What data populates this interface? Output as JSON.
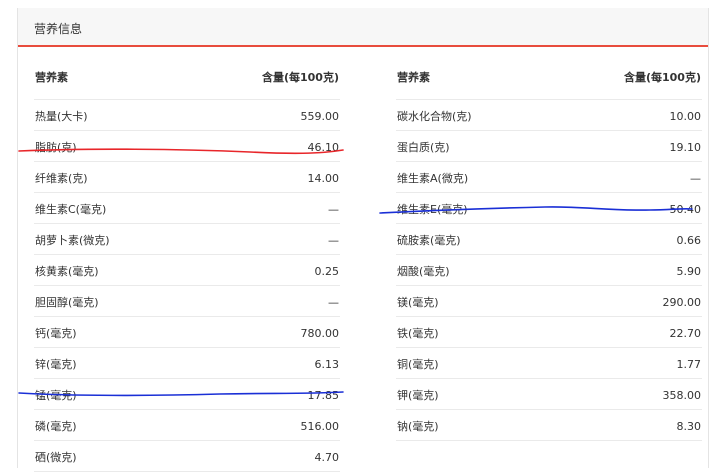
{
  "panel": {
    "title": "营养信息"
  },
  "headers": {
    "nutrient": "营养素",
    "amount": "含量(每100克)"
  },
  "left_rows": [
    {
      "name": "热量(大卡)",
      "value": "559.00"
    },
    {
      "name": "脂肪(克)",
      "value": "46.10"
    },
    {
      "name": "纤维素(克)",
      "value": "14.00"
    },
    {
      "name": "维生素C(毫克)",
      "value": "—"
    },
    {
      "name": "胡萝卜素(微克)",
      "value": "—"
    },
    {
      "name": "核黄素(毫克)",
      "value": "0.25"
    },
    {
      "name": "胆固醇(毫克)",
      "value": "—"
    },
    {
      "name": "钙(毫克)",
      "value": "780.00"
    },
    {
      "name": "锌(毫克)",
      "value": "6.13"
    },
    {
      "name": "锰(毫克)",
      "value": "17.85"
    },
    {
      "name": "磷(毫克)",
      "value": "516.00"
    },
    {
      "name": "硒(微克)",
      "value": "4.70"
    }
  ],
  "right_rows": [
    {
      "name": "碳水化合物(克)",
      "value": "10.00"
    },
    {
      "name": "蛋白质(克)",
      "value": "19.10"
    },
    {
      "name": "维生素A(微克)",
      "value": "—"
    },
    {
      "name": "维生素E(毫克)",
      "value": "50.40"
    },
    {
      "name": "硫胺素(毫克)",
      "value": "0.66"
    },
    {
      "name": "烟酸(毫克)",
      "value": "5.90"
    },
    {
      "name": "镁(毫克)",
      "value": "290.00"
    },
    {
      "name": "铁(毫克)",
      "value": "22.70"
    },
    {
      "name": "铜(毫克)",
      "value": "1.77"
    },
    {
      "name": "钾(毫克)",
      "value": "358.00"
    },
    {
      "name": "钠(毫克)",
      "value": "8.30"
    }
  ],
  "annotation_colors": {
    "red": "#e8262a",
    "blue": "#1a2fd6"
  }
}
